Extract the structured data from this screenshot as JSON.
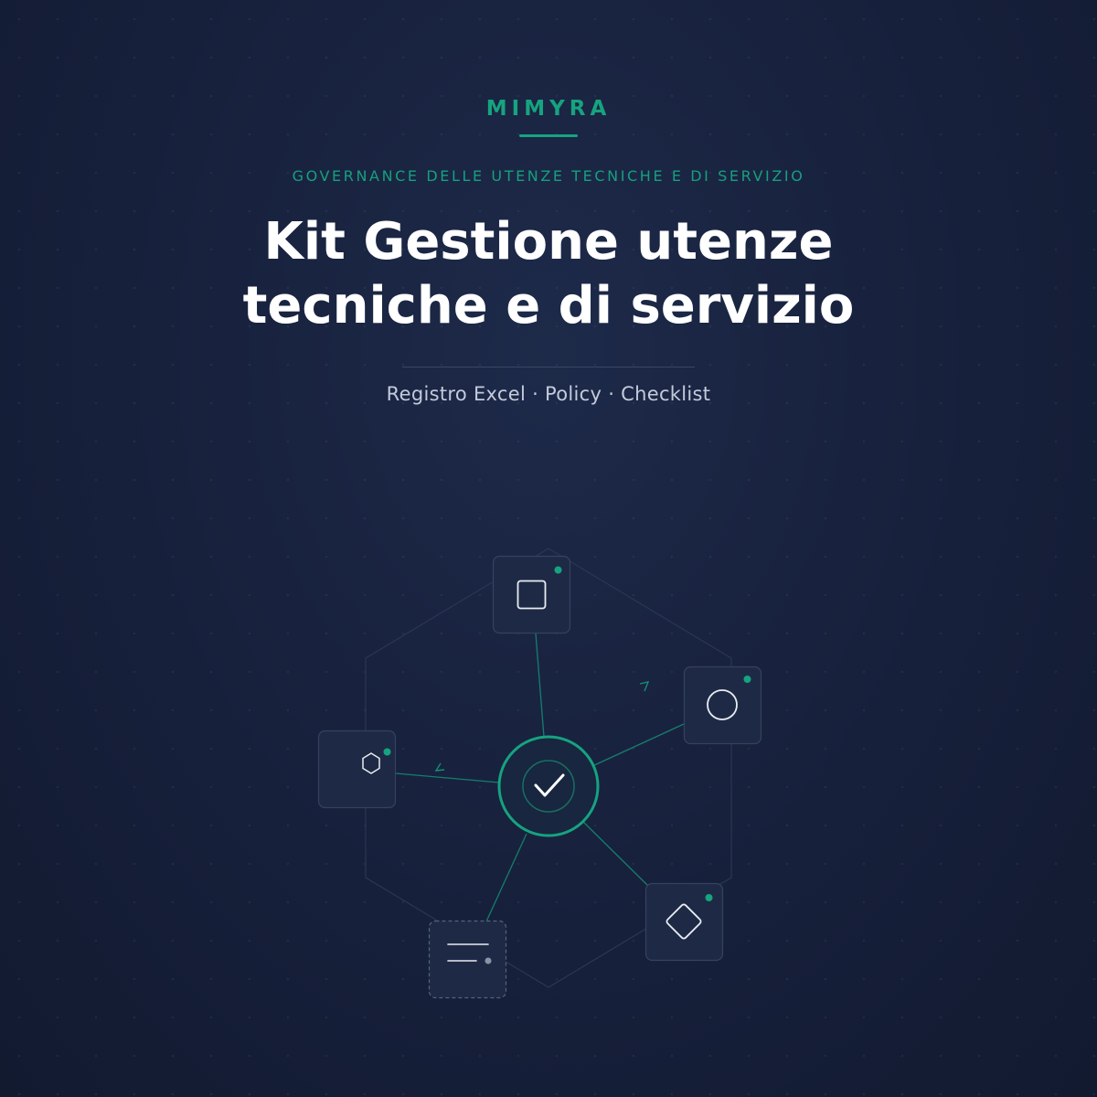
{
  "brand": {
    "name": "MIMYRA"
  },
  "kicker": "GOVERNANCE DELLE UTENZE TECNICHE E DI SERVIZIO",
  "title": {
    "line1": "Kit Gestione utenze",
    "line2": "tecniche e di servizio"
  },
  "subtitle": "Registro Excel · Policy · Checklist",
  "colors": {
    "accent": "#16a37f",
    "background": "#18223e",
    "card": "#1d2942",
    "card_border": "#33405c",
    "text": "#ffffff",
    "muted_text": "#c3cbdb"
  },
  "diagram": {
    "center_icon": "checkmark-icon",
    "nodes": [
      {
        "icon": "square-icon",
        "status": "active"
      },
      {
        "icon": "circle-icon",
        "status": "active"
      },
      {
        "icon": "hexagon-icon",
        "status": "active"
      },
      {
        "icon": "diamond-icon",
        "status": "active"
      },
      {
        "icon": "lines-icon",
        "status": "pending"
      }
    ]
  }
}
